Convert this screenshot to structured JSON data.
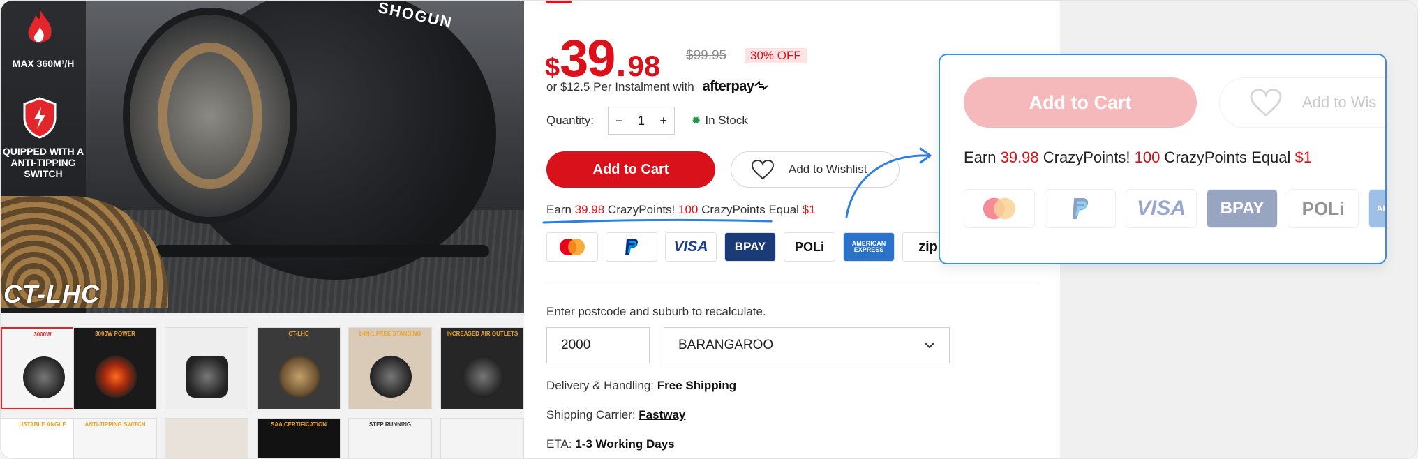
{
  "image": {
    "badge1": "MAX 360M³/H",
    "badge2": "QUIPPED WITH A ANTI-TIPPING SWITCH",
    "model": "CT-LHC",
    "brand": "SHOGUN"
  },
  "thumbnails": [
    {
      "caption": "3000W"
    },
    {
      "caption": "3000W POWER"
    },
    {
      "caption": ""
    },
    {
      "caption": "CT-LHC"
    },
    {
      "caption": "2-IN-1 FREE STANDING"
    },
    {
      "caption": "INCREASED AIR OUTLETS"
    },
    {
      "caption": "USTABLE ANGLE"
    },
    {
      "caption": "ANTI-TIPPING SWITCH"
    },
    {
      "caption": ""
    },
    {
      "caption": "SAA CERTIFICATION"
    },
    {
      "caption": "STEP RUNNING"
    },
    {
      "caption": ""
    }
  ],
  "product": {
    "price_currency": "$",
    "price_int": "39",
    "price_dot": ".",
    "price_cents": "98",
    "was_price": "$99.95",
    "discount": "30% OFF",
    "instalment_text": "or $12.5 Per Instalment with",
    "afterpay_brand": "afterpay",
    "quantity_label": "Quantity:",
    "quantity_value": "1",
    "qty_minus": "−",
    "qty_plus": "+",
    "stock_text": "In Stock",
    "add_to_cart": "Add to Cart",
    "add_to_wishlist": "Add to Wishlist",
    "earn_prefix": "Earn ",
    "earn_points": "39.98",
    "earn_mid": " CrazyPoints! ",
    "earn_hundred": "100",
    "earn_suffix": " CrazyPoints Equal ",
    "earn_dollar": "$1",
    "payments": [
      "VISA",
      "BPAY",
      "POLi",
      "AMERICAN EXPRESS",
      "zip"
    ],
    "postcode_label": "Enter postcode and suburb to recalculate.",
    "postcode_value": "2000",
    "suburb_value": "BARANGAROO",
    "delivery_label": "Delivery & Handling:",
    "delivery_value": "Free Shipping",
    "carrier_label": "Shipping Carrier:",
    "carrier_value": "Fastway",
    "eta_label": "ETA:",
    "eta_value": "1-3 Working Days"
  },
  "zoom": {
    "add_to_cart": "Add to Cart",
    "add_to_wishlist": "Add to Wis",
    "earn_prefix": "Earn ",
    "earn_points": "39.98",
    "earn_mid": " CrazyPoints! ",
    "earn_hundred": "100",
    "earn_suffix": " CrazyPoints Equal ",
    "earn_dollar": "$1",
    "payments": [
      "VISA",
      "BPAY",
      "POLi",
      "AE"
    ]
  },
  "colors": {
    "brand_red": "#d9111a",
    "callout_blue": "#3a8de6"
  }
}
